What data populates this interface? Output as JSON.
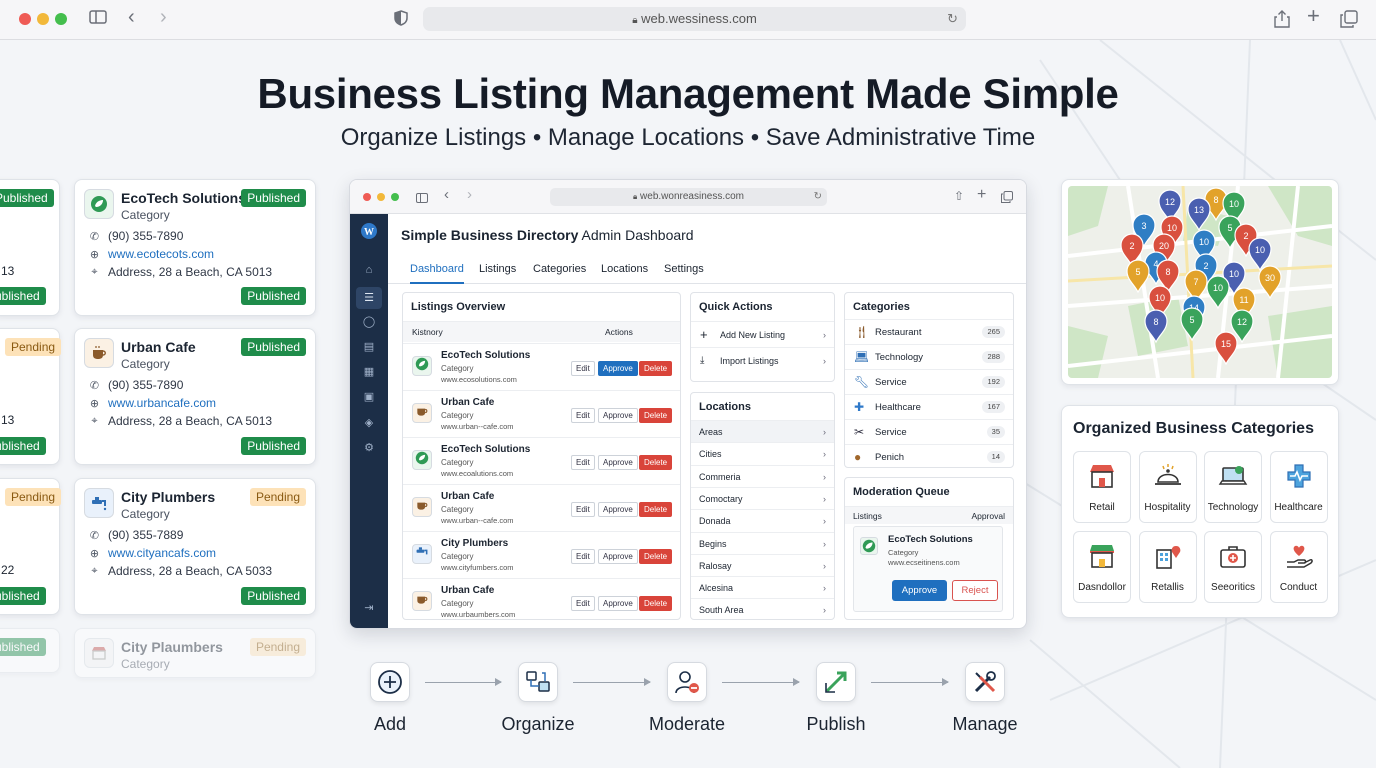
{
  "browser": {
    "url": "web.wessiness.com"
  },
  "headline": {
    "title": "Business Listing Management Made Simple",
    "subtitle": "Organize Listings • Manage Locations • Save Administrative Time"
  },
  "partial_cards": [
    {
      "badge_top": "Published",
      "address_fragment": "13",
      "badge_bottom": "ublished"
    },
    {
      "badge_top": "Pending",
      "address_fragment": "13",
      "badge_bottom": "ublished"
    },
    {
      "badge_top": "Pending",
      "address_fragment": "22",
      "badge_bottom": "ublished"
    },
    {
      "badge_top": "ublished"
    }
  ],
  "listing_cards": [
    {
      "name": "EcoTech Solutions",
      "category": "Category",
      "phone": "(90) 355-7890",
      "website": "www.ecotecots.com",
      "address": "Address, 28 a Beach, CA 5013",
      "status_top": "Published",
      "status_bottom": "Published",
      "icon": "leaf-icon"
    },
    {
      "name": "Urban Cafe",
      "category": "Category",
      "phone": "(90) 355-7890",
      "website": "www.urbancafe.com",
      "address": "Address, 28 a Beach, CA 5013",
      "status_top": "Published",
      "status_bottom": "Published",
      "icon": "coffee-icon"
    },
    {
      "name": "City Plumbers",
      "category": "Category",
      "phone": "(90) 355-7889",
      "website": "www.cityancafs.com",
      "address": "Address, 28 a Beach, CA 5033",
      "status_top": "Pending",
      "status_bottom": "Published",
      "icon": "faucet-icon"
    },
    {
      "name": "City Plaumbers",
      "category": "Category",
      "status_top": "Pending",
      "icon": "store-icon"
    }
  ],
  "admin": {
    "url": "web.wonreasiness.com",
    "title_bold": "Simple Business Directory",
    "title_rest": " Admin Dashboard",
    "tabs": [
      "Dashboard",
      "Listings",
      "Categories",
      "Locations",
      "Settings"
    ],
    "active_tab": "Dashboard",
    "listings_overview": {
      "title": "Listings Overview",
      "col_left": "Kistnory",
      "col_right": "Actions",
      "rows": [
        {
          "name": "EcoTech Solutions",
          "category": "Category",
          "url": "www.ecosolutions.com",
          "icon": "leaf-icon",
          "approve_style": "primary"
        },
        {
          "name": "Urban Cafe",
          "category": "Category",
          "url": "www.urban--cafe.com",
          "icon": "coffee-icon",
          "approve_style": "outline"
        },
        {
          "name": "EcoTech Solutions",
          "category": "Category",
          "url": "www.ecoalutions.com",
          "icon": "leaf-icon",
          "approve_style": "outline"
        },
        {
          "name": "Urban Cafe",
          "category": "Category",
          "url": "www.urban--cafe.com",
          "icon": "coffee-icon",
          "approve_style": "outline"
        },
        {
          "name": "City Plumbers",
          "category": "Category",
          "url": "www.cityfumbers.com",
          "icon": "faucet-icon",
          "approve_style": "outline"
        },
        {
          "name": "Urban Cafe",
          "category": "Category",
          "url": "www.urbaumbers.com",
          "icon": "coffee-icon",
          "approve_style": "outline"
        }
      ],
      "edit_label": "Edit",
      "approve_label": "Approve",
      "delete_label": "Delete"
    },
    "quick_actions": {
      "title": "Quick Actions",
      "items": [
        "Add New Listing",
        "Import Listings"
      ]
    },
    "locations": {
      "title": "Locations",
      "items": [
        "Areas",
        "Cities",
        "Commeria",
        "Comoctary",
        "Donada",
        "Begins",
        "Ralosay",
        "Alcesina",
        "South Area"
      ]
    },
    "categories": {
      "title": "Categories",
      "items": [
        {
          "name": "Restaurant",
          "count": "265",
          "icon": "fork-knife-icon"
        },
        {
          "name": "Technology",
          "count": "288",
          "icon": "laptop-icon"
        },
        {
          "name": "Service",
          "count": "192",
          "icon": "wrench-icon"
        },
        {
          "name": "Healthcare",
          "count": "167",
          "icon": "medical-cross-icon"
        },
        {
          "name": "Service",
          "count": "35",
          "icon": "tools-icon"
        },
        {
          "name": "Penich",
          "count": "14",
          "icon": "basket-icon"
        }
      ]
    },
    "moderation": {
      "title": "Moderation Queue",
      "col_left": "Listings",
      "col_right": "Approval",
      "item_name": "EcoTech Solutions",
      "item_category": "Category",
      "item_url": "www.ecseitinens.com",
      "approve": "Approve",
      "reject": "Reject"
    }
  },
  "map": {
    "pins": [
      {
        "label": "12",
        "color": "#4a5fb0"
      },
      {
        "label": "8",
        "color": "#e2a22a"
      },
      {
        "label": "10",
        "color": "#3aa35b"
      },
      {
        "label": "13",
        "color": "#4a5fb0"
      },
      {
        "label": "3",
        "color": "#2f7ec4"
      },
      {
        "label": "10",
        "color": "#d9503f"
      },
      {
        "label": "5",
        "color": "#3aa35b"
      },
      {
        "label": "20",
        "color": "#d9503f"
      },
      {
        "label": "10",
        "color": "#2f7ec4"
      },
      {
        "label": "2",
        "color": "#d9503f"
      },
      {
        "label": "2",
        "color": "#d9503f"
      },
      {
        "label": "4",
        "color": "#2f7ec4"
      },
      {
        "label": "5",
        "color": "#e2a22a"
      },
      {
        "label": "8",
        "color": "#d9503f"
      },
      {
        "label": "2",
        "color": "#2f7ec4"
      },
      {
        "label": "10",
        "color": "#4a5fb0"
      },
      {
        "label": "10",
        "color": "#4a5fb0"
      },
      {
        "label": "30",
        "color": "#e2a22a"
      },
      {
        "label": "7",
        "color": "#e2a22a"
      },
      {
        "label": "10",
        "color": "#3aa35b"
      },
      {
        "label": "10",
        "color": "#d9503f"
      },
      {
        "label": "11",
        "color": "#e2a22a"
      },
      {
        "label": "14",
        "color": "#2f7ec4"
      },
      {
        "label": "8",
        "color": "#4a5fb0"
      },
      {
        "label": "5",
        "color": "#3aa35b"
      },
      {
        "label": "12",
        "color": "#3aa35b"
      },
      {
        "label": "15",
        "color": "#d9503f"
      }
    ]
  },
  "org_categories": {
    "title": "Organized Business Categories",
    "tiles": [
      {
        "label": "Retail",
        "icon": "storefront-icon"
      },
      {
        "label": "Hospitality",
        "icon": "cloche-icon"
      },
      {
        "label": "Technology",
        "icon": "laptop-icon"
      },
      {
        "label": "Healthcare",
        "icon": "medical-cross-icon"
      },
      {
        "label": "Dasndollor",
        "icon": "shop-icon"
      },
      {
        "label": "Retallis",
        "icon": "building-icon"
      },
      {
        "label": "Seeoritics",
        "icon": "medkit-icon"
      },
      {
        "label": "Conduct",
        "icon": "hand-heart-icon"
      }
    ]
  },
  "workflow": {
    "steps": [
      {
        "label": "Add",
        "icon": "plus-circle-icon"
      },
      {
        "label": "Organize",
        "icon": "organize-icon"
      },
      {
        "label": "Moderate",
        "icon": "user-minus-icon"
      },
      {
        "label": "Publish",
        "icon": "arrows-out-icon"
      },
      {
        "label": "Manage",
        "icon": "tools-icon"
      }
    ]
  }
}
